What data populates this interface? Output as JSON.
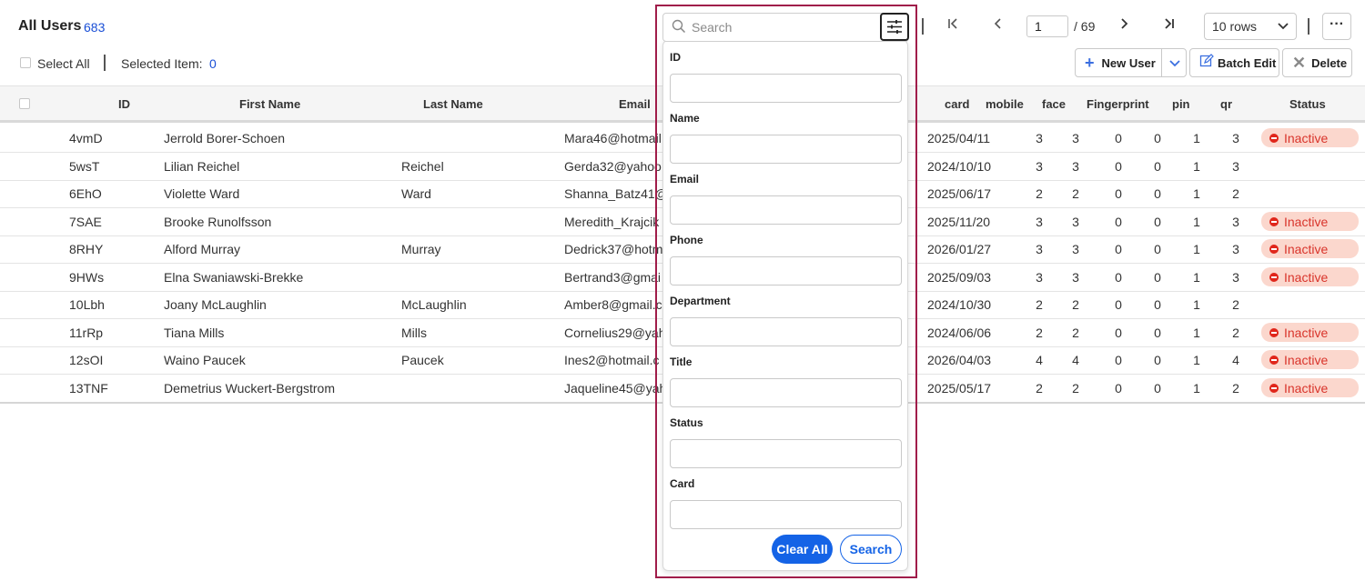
{
  "header": {
    "title": "All Users",
    "count": "683",
    "select_all": "Select All",
    "selected_label": "Selected Item:",
    "selected_count": "0"
  },
  "pagination": {
    "page": "1",
    "total": "/ 69",
    "rows": "10 rows",
    "more": "···"
  },
  "actions": {
    "new_user": "New User",
    "batch_edit": "Batch Edit",
    "delete": "Delete"
  },
  "columns": {
    "id": "ID",
    "first_name": "First Name",
    "last_name": "Last Name",
    "email": "Email",
    "card": "card",
    "mobile": "mobile",
    "face": "face",
    "fingerprint": "Fingerprint",
    "pin": "pin",
    "qr": "qr",
    "status": "Status"
  },
  "rows": [
    {
      "id": "4vmD",
      "first": "Jerrold Borer-Schoen",
      "last": "",
      "email": "Mara46@hotmail",
      "card": "2025/04/11",
      "mobile": "3",
      "face": "3",
      "fingerprint": "0",
      "c4": "0",
      "pin": "1",
      "qr": "3",
      "status": "Inactive"
    },
    {
      "id": "5wsT",
      "first": "Lilian Reichel",
      "last": "Reichel",
      "email": "Gerda32@yahoo.",
      "card": "2024/10/10",
      "mobile": "3",
      "face": "3",
      "fingerprint": "0",
      "c4": "0",
      "pin": "1",
      "qr": "3",
      "status": ""
    },
    {
      "id": "6EhO",
      "first": "Violette Ward",
      "last": "Ward",
      "email": "Shanna_Batz41@",
      "card": "2025/06/17",
      "mobile": "2",
      "face": "2",
      "fingerprint": "0",
      "c4": "0",
      "pin": "1",
      "qr": "2",
      "status": ""
    },
    {
      "id": "7SAE",
      "first": "Brooke Runolfsson",
      "last": "",
      "email": "Meredith_Krajcik",
      "card": "2025/11/20",
      "mobile": "3",
      "face": "3",
      "fingerprint": "0",
      "c4": "0",
      "pin": "1",
      "qr": "3",
      "status": "Inactive"
    },
    {
      "id": "8RHY",
      "first": "Alford Murray",
      "last": "Murray",
      "email": "Dedrick37@hotm",
      "card": "2026/01/27",
      "mobile": "3",
      "face": "3",
      "fingerprint": "0",
      "c4": "0",
      "pin": "1",
      "qr": "3",
      "status": "Inactive"
    },
    {
      "id": "9HWs",
      "first": "Elna Swaniawski-Brekke",
      "last": "",
      "email": "Bertrand3@gmai",
      "card": "2025/09/03",
      "mobile": "3",
      "face": "3",
      "fingerprint": "0",
      "c4": "0",
      "pin": "1",
      "qr": "3",
      "status": "Inactive"
    },
    {
      "id": "10Lbh",
      "first": "Joany McLaughlin",
      "last": "McLaughlin",
      "email": "Amber8@gmail.c",
      "card": "2024/10/30",
      "mobile": "2",
      "face": "2",
      "fingerprint": "0",
      "c4": "0",
      "pin": "1",
      "qr": "2",
      "status": ""
    },
    {
      "id": "11rRp",
      "first": "Tiana Mills",
      "last": "Mills",
      "email": "Cornelius29@yah",
      "card": "2024/06/06",
      "mobile": "2",
      "face": "2",
      "fingerprint": "0",
      "c4": "0",
      "pin": "1",
      "qr": "2",
      "status": "Inactive"
    },
    {
      "id": "12sOI",
      "first": "Waino Paucek",
      "last": "Paucek",
      "email": "Ines2@hotmail.c",
      "card": "2026/04/03",
      "mobile": "4",
      "face": "4",
      "fingerprint": "0",
      "c4": "0",
      "pin": "1",
      "qr": "4",
      "status": "Inactive"
    },
    {
      "id": "13TNF",
      "first": "Demetrius Wuckert-Bergstrom",
      "last": "",
      "email": "Jaqueline45@yah",
      "card": "2025/05/17",
      "mobile": "2",
      "face": "2",
      "fingerprint": "0",
      "c4": "0",
      "pin": "1",
      "qr": "2",
      "status": "Inactive"
    }
  ],
  "filter": {
    "search_placeholder": "Search",
    "fields": [
      "ID",
      "Name",
      "Email",
      "Phone",
      "Department",
      "Title",
      "Status",
      "Card"
    ],
    "clear_all": "Clear All",
    "search": "Search"
  }
}
